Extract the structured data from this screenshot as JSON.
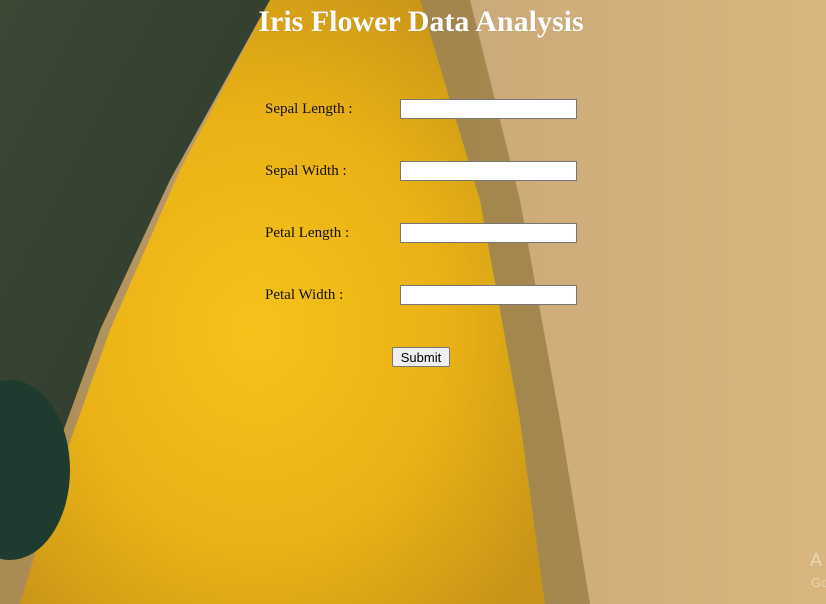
{
  "page": {
    "title": "Iris Flower Data Analysis"
  },
  "form": {
    "fields": [
      {
        "label": "Sepal Length :",
        "value": ""
      },
      {
        "label": "Sepal Width :",
        "value": ""
      },
      {
        "label": "Petal Length :",
        "value": ""
      },
      {
        "label": "Petal Width :",
        "value": ""
      }
    ],
    "submit_label": "Submit"
  },
  "watermark": {
    "line1": "A",
    "line2": "Go"
  },
  "colors": {
    "title": "#ffffff",
    "label": "#111111",
    "petal_yellow": "#f2b814",
    "background_tan": "#cfae82",
    "dark_green": "#2f3a2f"
  }
}
